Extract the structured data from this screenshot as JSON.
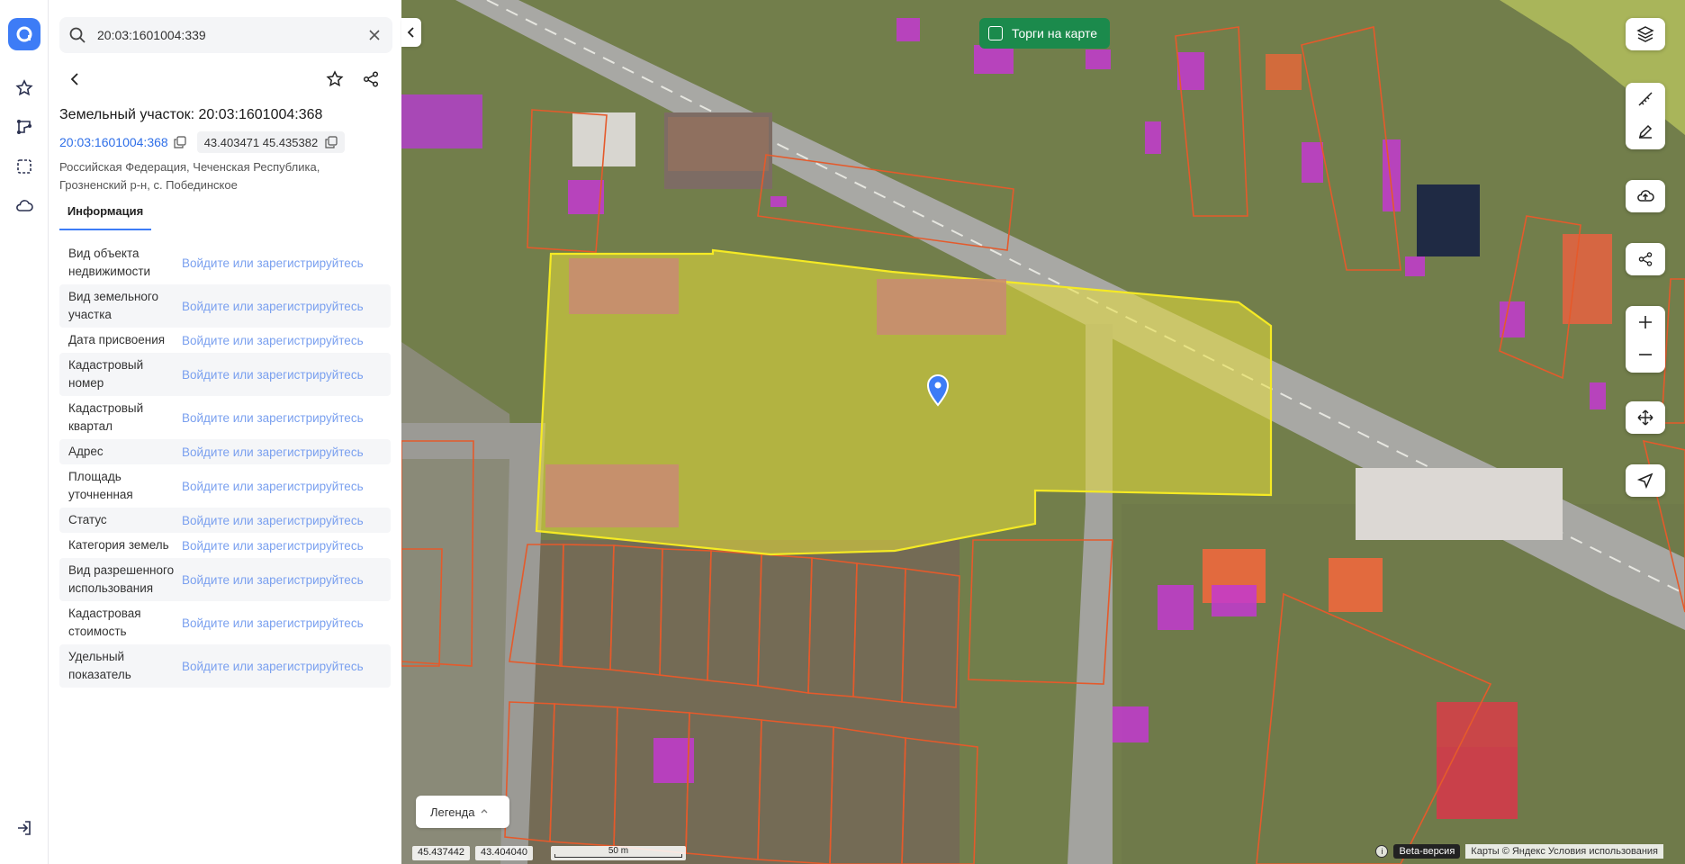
{
  "search": {
    "value": "20:03:1601004:339"
  },
  "object": {
    "title": "Земельный участок: 20:03:1601004:368",
    "cadastral_link": "20:03:1601004:368",
    "coords": "43.403471 45.435382",
    "address": "Российская Федерация, Чеченская Республика, Грозненский р-н, с. Побединское"
  },
  "tabs": {
    "info": "Информация"
  },
  "props": [
    {
      "label": "Вид объекта недвижимости",
      "value": "Войдите или зарегистрируйтесь"
    },
    {
      "label": "Вид земельного участка",
      "value": "Войдите или зарегистрируйтесь"
    },
    {
      "label": "Дата присвоения",
      "value": "Войдите или зарегистрируйтесь"
    },
    {
      "label": "Кадастровый номер",
      "value": "Войдите или зарегистрируйтесь"
    },
    {
      "label": "Кадастровый квартал",
      "value": "Войдите или зарегистрируйтесь"
    },
    {
      "label": "Адрес",
      "value": "Войдите или зарегистрируйтесь"
    },
    {
      "label": "Площадь уточненная",
      "value": "Войдите или зарегистрируйтесь"
    },
    {
      "label": "Статус",
      "value": "Войдите или зарегистрируйтесь"
    },
    {
      "label": "Категория земель",
      "value": "Войдите или зарегистрируйтесь"
    },
    {
      "label": "Вид разрешенного использования",
      "value": "Войдите или зарегистрируйтесь"
    },
    {
      "label": "Кадастровая стоимость",
      "value": "Войдите или зарегистрируйтесь"
    },
    {
      "label": "Удельный показатель",
      "value": "Войдите или зарегистрируйтесь"
    }
  ],
  "map": {
    "torgi_label": "Торги на карте",
    "legend_label": "Легенда",
    "coord_lat": "45.437442",
    "coord_lon": "43.404040",
    "scale_label": "50 m",
    "beta_label": "Beta-версия",
    "attribution": "Карты © Яндекс   Условия использования"
  },
  "colors": {
    "accent": "#3d7cf6",
    "torgi": "#1b8a4c",
    "parcel_fill": "#e7df3a",
    "parcel_border": "#e55a2b",
    "building": "#c44ec8"
  },
  "icons": [
    "logo-icon",
    "star-icon",
    "route-icon",
    "select-area-icon",
    "cloud-icon",
    "logout-icon",
    "search-icon",
    "close-icon",
    "back-icon",
    "share-icon",
    "copy-icon",
    "layers-icon",
    "ruler-icon",
    "edit-icon",
    "upload-icon",
    "zoom-in-icon",
    "zoom-out-icon",
    "move-icon",
    "locate-icon",
    "map-pin-icon"
  ]
}
